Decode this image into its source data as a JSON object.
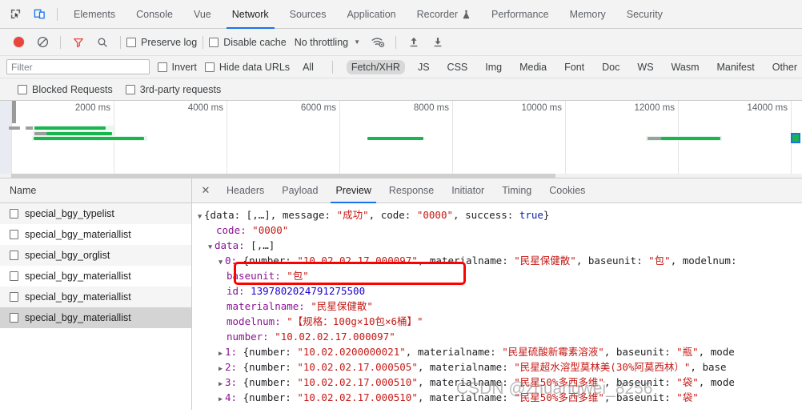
{
  "window": {
    "devtools_icons": [
      {
        "name": "inspect-element-icon"
      },
      {
        "name": "device-toolbar-icon"
      }
    ]
  },
  "main_tabs": [
    {
      "label": "Elements",
      "active": false
    },
    {
      "label": "Console",
      "active": false
    },
    {
      "label": "Vue",
      "active": false
    },
    {
      "label": "Network",
      "active": true
    },
    {
      "label": "Sources",
      "active": false
    },
    {
      "label": "Application",
      "active": false
    },
    {
      "label": "Recorder",
      "active": false,
      "experimental": true
    },
    {
      "label": "Performance",
      "active": false
    },
    {
      "label": "Memory",
      "active": false
    },
    {
      "label": "Security",
      "active": false
    }
  ],
  "network_toolbar": {
    "record_title": "record-button",
    "clear_title": "clear-button",
    "filter_title": "filter-button",
    "search_title": "search-button",
    "preserve_log": {
      "label": "Preserve log",
      "checked": false
    },
    "disable_cache": {
      "label": "Disable cache",
      "checked": false
    },
    "throttling": {
      "value": "No throttling"
    },
    "network_conditions_title": "network-conditions-icon",
    "import_title": "import-har-icon",
    "export_title": "export-har-icon"
  },
  "filter_bar": {
    "filter_placeholder": "Filter",
    "filter_value": "",
    "invert": {
      "label": "Invert",
      "checked": false
    },
    "hide_data_urls": {
      "label": "Hide data URLs",
      "checked": false
    },
    "types": [
      {
        "label": "All",
        "active": false
      },
      {
        "label": "Fetch/XHR",
        "active": true
      },
      {
        "label": "JS",
        "active": false
      },
      {
        "label": "CSS",
        "active": false
      },
      {
        "label": "Img",
        "active": false
      },
      {
        "label": "Media",
        "active": false
      },
      {
        "label": "Font",
        "active": false
      },
      {
        "label": "Doc",
        "active": false
      },
      {
        "label": "WS",
        "active": false
      },
      {
        "label": "Wasm",
        "active": false
      },
      {
        "label": "Manifest",
        "active": false
      },
      {
        "label": "Other",
        "active": false
      }
    ],
    "blocked_requests": {
      "label": "Blocked Requests",
      "checked": false
    },
    "third_party_requests": {
      "label": "3rd-party requests",
      "checked": false
    }
  },
  "overview": {
    "ticks": [
      "2000 ms",
      "4000 ms",
      "6000 ms",
      "8000 ms",
      "10000 ms",
      "12000 ms",
      "14000 ms"
    ],
    "colors": {
      "bar": "#19b64f",
      "wait": "#9e9e9e",
      "selection": "#1a73e8"
    }
  },
  "request_list": {
    "header": "Name",
    "rows": [
      {
        "name": "special_bgy_typelist",
        "selected": false
      },
      {
        "name": "special_bgy_materiallist",
        "selected": false
      },
      {
        "name": "special_bgy_orglist",
        "selected": false
      },
      {
        "name": "special_bgy_materiallist",
        "selected": false
      },
      {
        "name": "special_bgy_materiallist",
        "selected": false
      },
      {
        "name": "special_bgy_materiallist",
        "selected": true
      }
    ]
  },
  "detail_tabs": [
    {
      "label": "Headers",
      "active": false
    },
    {
      "label": "Payload",
      "active": false
    },
    {
      "label": "Preview",
      "active": true
    },
    {
      "label": "Response",
      "active": false
    },
    {
      "label": "Initiator",
      "active": false
    },
    {
      "label": "Timing",
      "active": false
    },
    {
      "label": "Cookies",
      "active": false
    }
  ],
  "preview": {
    "root_summary": {
      "prefix": "{data: [,…], message: ",
      "message": "\"成功\"",
      "mid": ", code: ",
      "code": "\"0000\"",
      "suffix": ", success: ",
      "success": "true",
      "close": "}"
    },
    "code_key": "code:",
    "code_val": "\"0000\"",
    "data_key": "data:",
    "data_val": "[,…]",
    "item0": {
      "index": "0:",
      "open": "{number: ",
      "number": "\"10.02.02.17.000097\"",
      "mid1": ", materialname: ",
      "materialname": "\"民星保健散\"",
      "mid2": ", baseunit: ",
      "baseunit": "\"包\"",
      "mid3": ", modelnum:",
      "fields": [
        {
          "key": "baseunit:",
          "value": "\"包\"",
          "type": "string"
        },
        {
          "key": "id:",
          "value": "1397802024791275500",
          "type": "number"
        },
        {
          "key": "materialname:",
          "value": "\"民星保健散\"",
          "type": "string"
        },
        {
          "key": "modelnum:",
          "value": "\"【规格：100g×10包×6桶】\"",
          "type": "string"
        },
        {
          "key": "number:",
          "value": "\"10.02.02.17.000097\"",
          "type": "string"
        }
      ]
    },
    "collapsed": [
      {
        "index": "1:",
        "open": "{number: ",
        "number": "\"10.02.0200000021\"",
        "mid1": ", materialname: ",
        "materialname": "\"民星硫酸新霉素溶液\"",
        "mid2": ", baseunit: ",
        "baseunit": "\"瓶\"",
        "mid3": ", mode"
      },
      {
        "index": "2:",
        "open": "{number: ",
        "number": "\"10.02.02.17.000505\"",
        "mid1": ", materialname: ",
        "materialname": "\"民星超水溶型莫林美(30%阿莫西林）\"",
        "mid2": ", base",
        "baseunit": "",
        "mid3": ""
      },
      {
        "index": "3:",
        "open": "{number: ",
        "number": "\"10.02.02.17.000510\"",
        "mid1": ", materialname: ",
        "materialname": "\"民星50%多西多维\"",
        "mid2": ", baseunit: ",
        "baseunit": "\"袋\"",
        "mid3": ", mode"
      },
      {
        "index": "4:",
        "open": "{number: ",
        "number": "\"10.02.02.17.000510\"",
        "mid1": ", materialname: ",
        "materialname": "\"民星50%多西多维\"",
        "mid2": ", baseunit: ",
        "baseunit": "\"袋\"",
        "mid3": ""
      }
    ],
    "annotation_color": "#ff0000",
    "watermark": "CSDN @zhuangwei_8256"
  }
}
